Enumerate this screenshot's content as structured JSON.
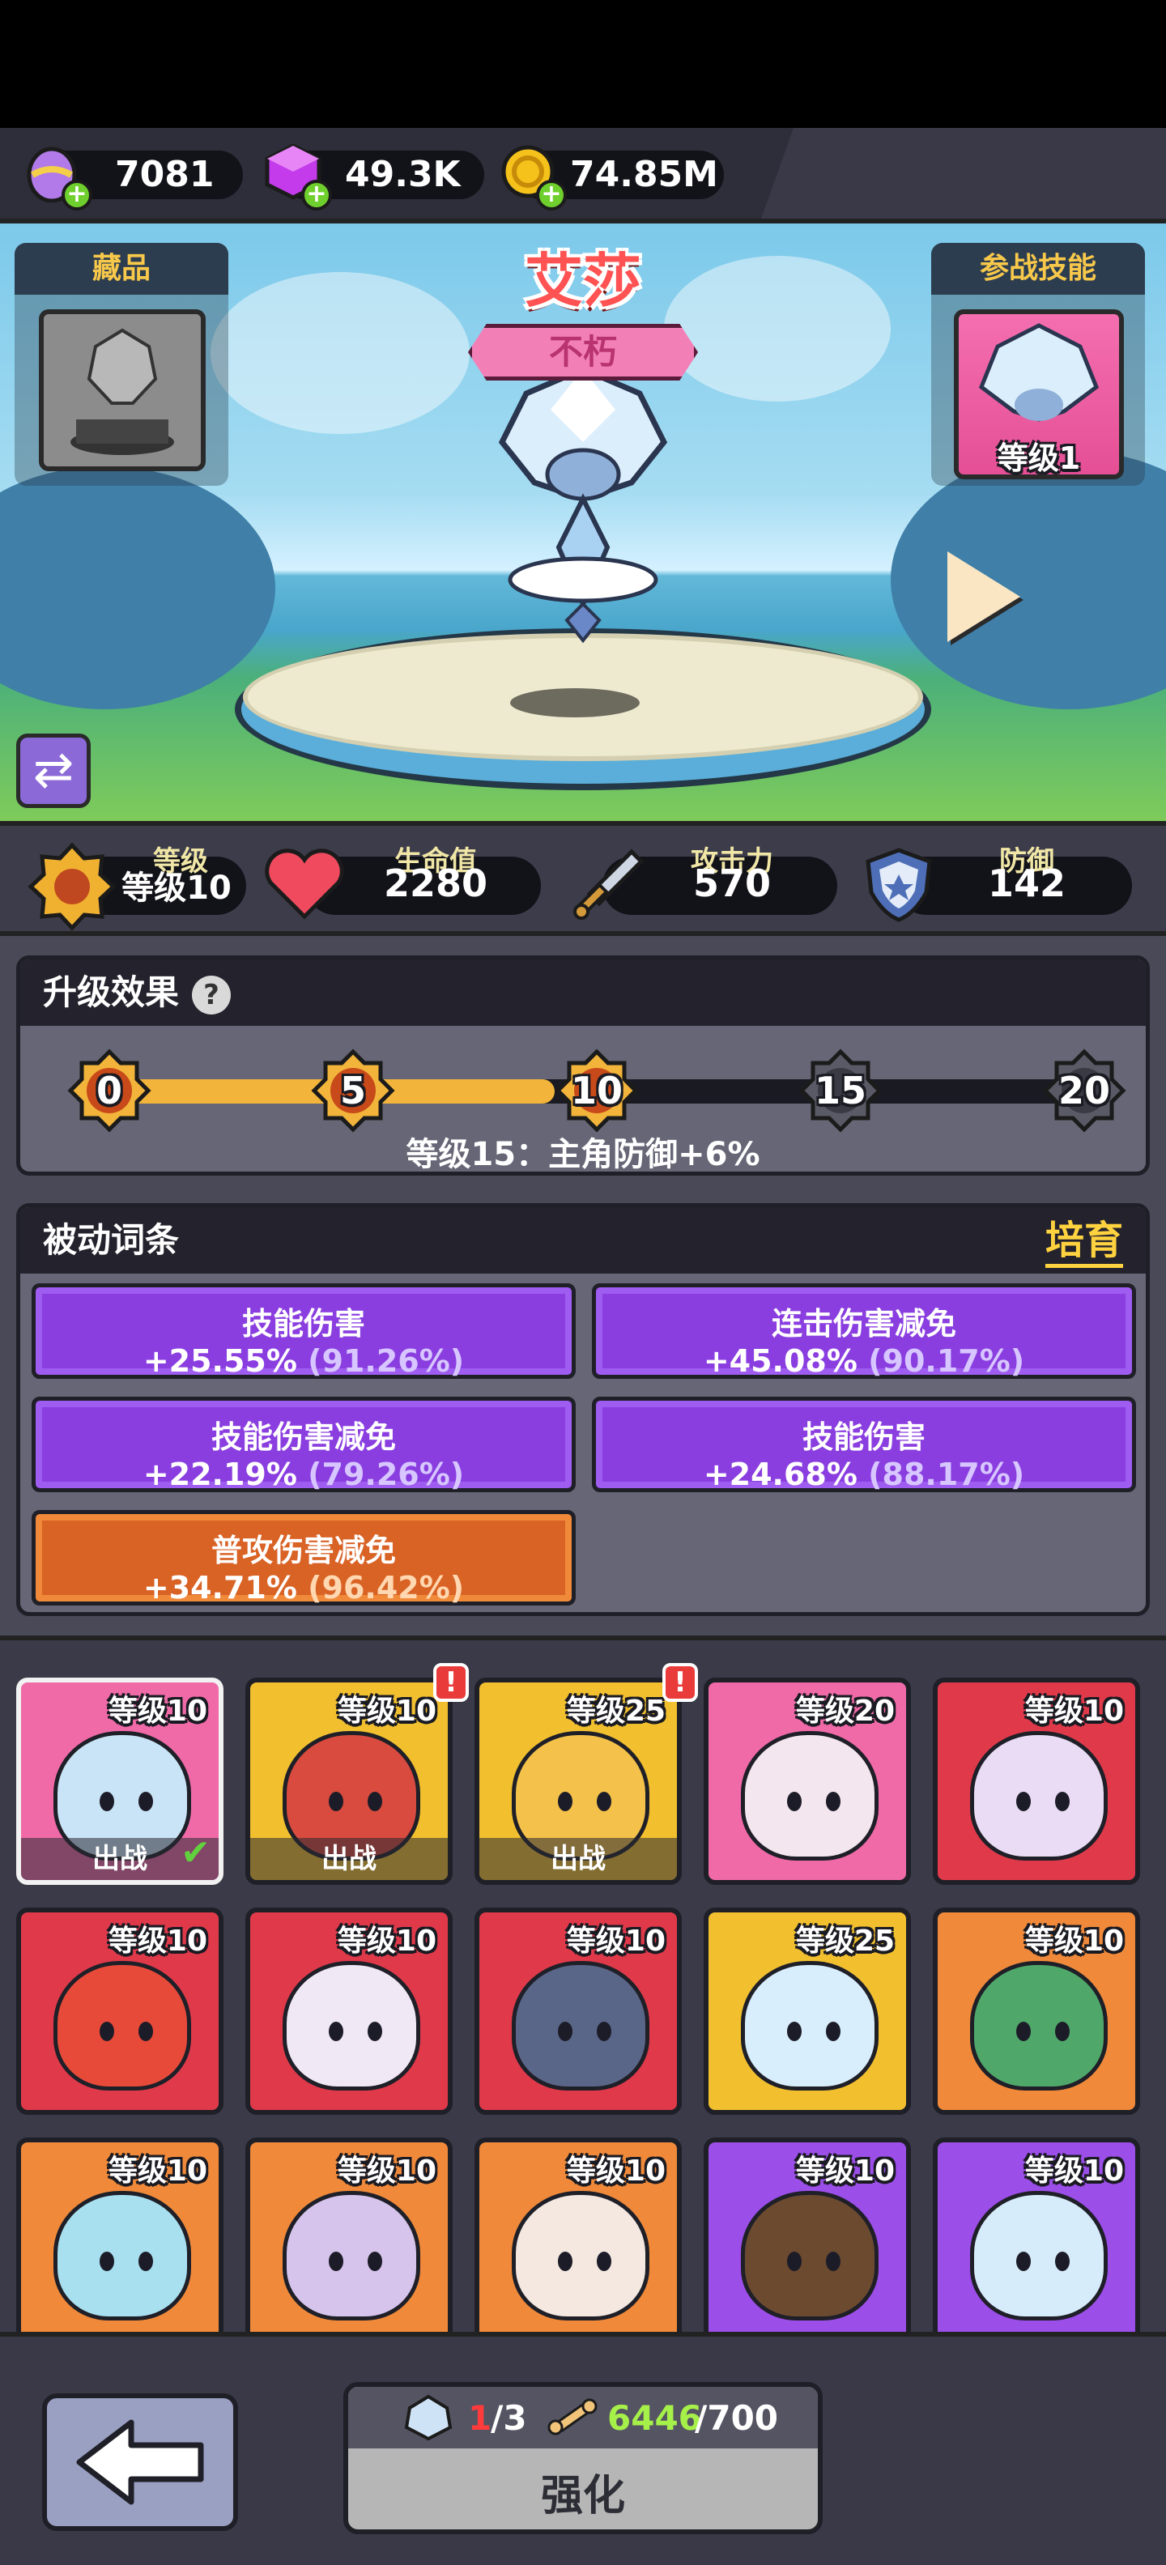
{
  "currencies": [
    {
      "name": "egg",
      "value": "7081",
      "color": "#b17ae8"
    },
    {
      "name": "gem",
      "value": "49.3K",
      "color": "#c33bea"
    },
    {
      "name": "gold",
      "value": "74.85M",
      "color": "#f5c21b"
    }
  ],
  "hero": {
    "name": "艾莎",
    "rank": "不朽",
    "collection_label": "藏品",
    "skill_label": "参战技能",
    "skill_level": "等级1"
  },
  "stats": [
    {
      "label": "等级",
      "value": "等级10"
    },
    {
      "label": "生命值",
      "value": "2280"
    },
    {
      "label": "攻击力",
      "value": "570"
    },
    {
      "label": "防御",
      "value": "142"
    }
  ],
  "upgrade": {
    "title": "升级效果",
    "help": "?",
    "milestones": [
      "0",
      "5",
      "10",
      "15",
      "20"
    ],
    "progress_level": 10,
    "max_level": 20,
    "next_effect": "等级15：主角防御+6%"
  },
  "passives": {
    "title": "被动词条",
    "cultivate_label": "培育",
    "items": [
      {
        "name": "技能伤害",
        "value": "+25.55%",
        "pct": "(91.26%)",
        "tier": "purple"
      },
      {
        "name": "连击伤害减免",
        "value": "+45.08%",
        "pct": "(90.17%)",
        "tier": "purple"
      },
      {
        "name": "技能伤害减免",
        "value": "+22.19%",
        "pct": "(79.26%)",
        "tier": "purple"
      },
      {
        "name": "技能伤害",
        "value": "+24.68%",
        "pct": "(88.17%)",
        "tier": "purple"
      },
      {
        "name": "普攻伤害减免",
        "value": "+34.71%",
        "pct": "(96.42%)",
        "tier": "orange"
      }
    ]
  },
  "pets": [
    {
      "level": "等级10",
      "deploy": "出战",
      "checked": true,
      "alert": false,
      "bg": "#f06aa8",
      "body": "#c9e4f6"
    },
    {
      "level": "等级10",
      "deploy": "出战",
      "checked": false,
      "alert": true,
      "bg": "#f2c02f",
      "body": "#d84b3e"
    },
    {
      "level": "等级25",
      "deploy": "出战",
      "checked": false,
      "alert": true,
      "bg": "#f2c02f",
      "body": "#f4c24a"
    },
    {
      "level": "等级20",
      "deploy": "",
      "checked": false,
      "alert": false,
      "bg": "#f06aa8",
      "body": "#f4e6ef"
    },
    {
      "level": "等级10",
      "deploy": "",
      "checked": false,
      "alert": false,
      "bg": "#e03a4a",
      "body": "#e9dcf4"
    },
    {
      "level": "等级10",
      "deploy": "",
      "checked": false,
      "alert": false,
      "bg": "#e03a4a",
      "body": "#e84a3a"
    },
    {
      "level": "等级10",
      "deploy": "",
      "checked": false,
      "alert": false,
      "bg": "#e03a4a",
      "body": "#f1e8f5"
    },
    {
      "level": "等级10",
      "deploy": "",
      "checked": false,
      "alert": false,
      "bg": "#e03a4a",
      "body": "#5a6688"
    },
    {
      "level": "等级25",
      "deploy": "",
      "checked": false,
      "alert": false,
      "bg": "#f2c02f",
      "body": "#d9eefc"
    },
    {
      "level": "等级10",
      "deploy": "",
      "checked": false,
      "alert": false,
      "bg": "#f08a3a",
      "body": "#4fa86a"
    },
    {
      "level": "等级10",
      "deploy": "",
      "checked": false,
      "alert": false,
      "bg": "#f08a3a",
      "body": "#a8e0f0"
    },
    {
      "level": "等级10",
      "deploy": "",
      "checked": false,
      "alert": false,
      "bg": "#f08a3a",
      "body": "#d6c4ec"
    },
    {
      "level": "等级10",
      "deploy": "",
      "checked": false,
      "alert": false,
      "bg": "#f08a3a",
      "body": "#f4e8e0"
    },
    {
      "level": "等级10",
      "deploy": "",
      "checked": false,
      "alert": false,
      "bg": "#9b4ee8",
      "body": "#6b4a30"
    },
    {
      "level": "等级10",
      "deploy": "",
      "checked": false,
      "alert": false,
      "bg": "#9b4ee8",
      "body": "#d6ecfa"
    }
  ],
  "bottom": {
    "shard_have": "1",
    "shard_need": "/3",
    "bone_have": "6446",
    "bone_need": "/700",
    "enhance_label": "强化"
  }
}
